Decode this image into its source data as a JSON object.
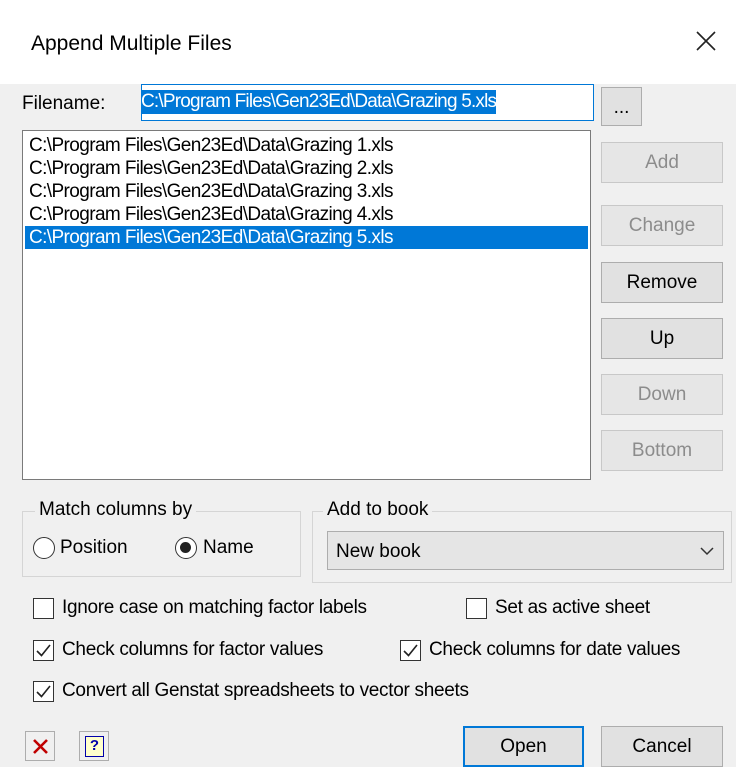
{
  "dialog": {
    "title": "Append Multiple Files"
  },
  "filename": {
    "label": "Filename:",
    "value": "C:\\Program Files\\Gen23Ed\\Data\\Grazing 5.xls"
  },
  "browse_label": "...",
  "files": [
    "C:\\Program Files\\Gen23Ed\\Data\\Grazing 1.xls",
    "C:\\Program Files\\Gen23Ed\\Data\\Grazing 2.xls",
    "C:\\Program Files\\Gen23Ed\\Data\\Grazing 3.xls",
    "C:\\Program Files\\Gen23Ed\\Data\\Grazing 4.xls",
    "C:\\Program Files\\Gen23Ed\\Data\\Grazing 5.xls"
  ],
  "selected_file_index": 4,
  "side_buttons": {
    "add": "Add",
    "change": "Change",
    "remove": "Remove",
    "up": "Up",
    "down": "Down",
    "bottom": "Bottom"
  },
  "match_columns": {
    "title": "Match columns by",
    "options": [
      "Position",
      "Name"
    ],
    "selected": "Name"
  },
  "add_to_book": {
    "title": "Add to book",
    "value": "New book"
  },
  "options": {
    "ignore_case": {
      "label": "Ignore case on matching factor labels",
      "checked": false
    },
    "set_active": {
      "label": "Set as active sheet",
      "checked": false
    },
    "check_factor": {
      "label": "Check columns for factor values",
      "checked": true
    },
    "check_date": {
      "label": "Check columns for date values",
      "checked": true
    },
    "convert_vector": {
      "label": "Convert all Genstat spreadsheets to vector sheets",
      "checked": true
    }
  },
  "footer": {
    "open": "Open",
    "cancel": "Cancel",
    "help_glyph": "?"
  },
  "colors": {
    "selection": "#0078d7",
    "clear_icon": "#c00000",
    "help_icon": "#0000aa"
  }
}
